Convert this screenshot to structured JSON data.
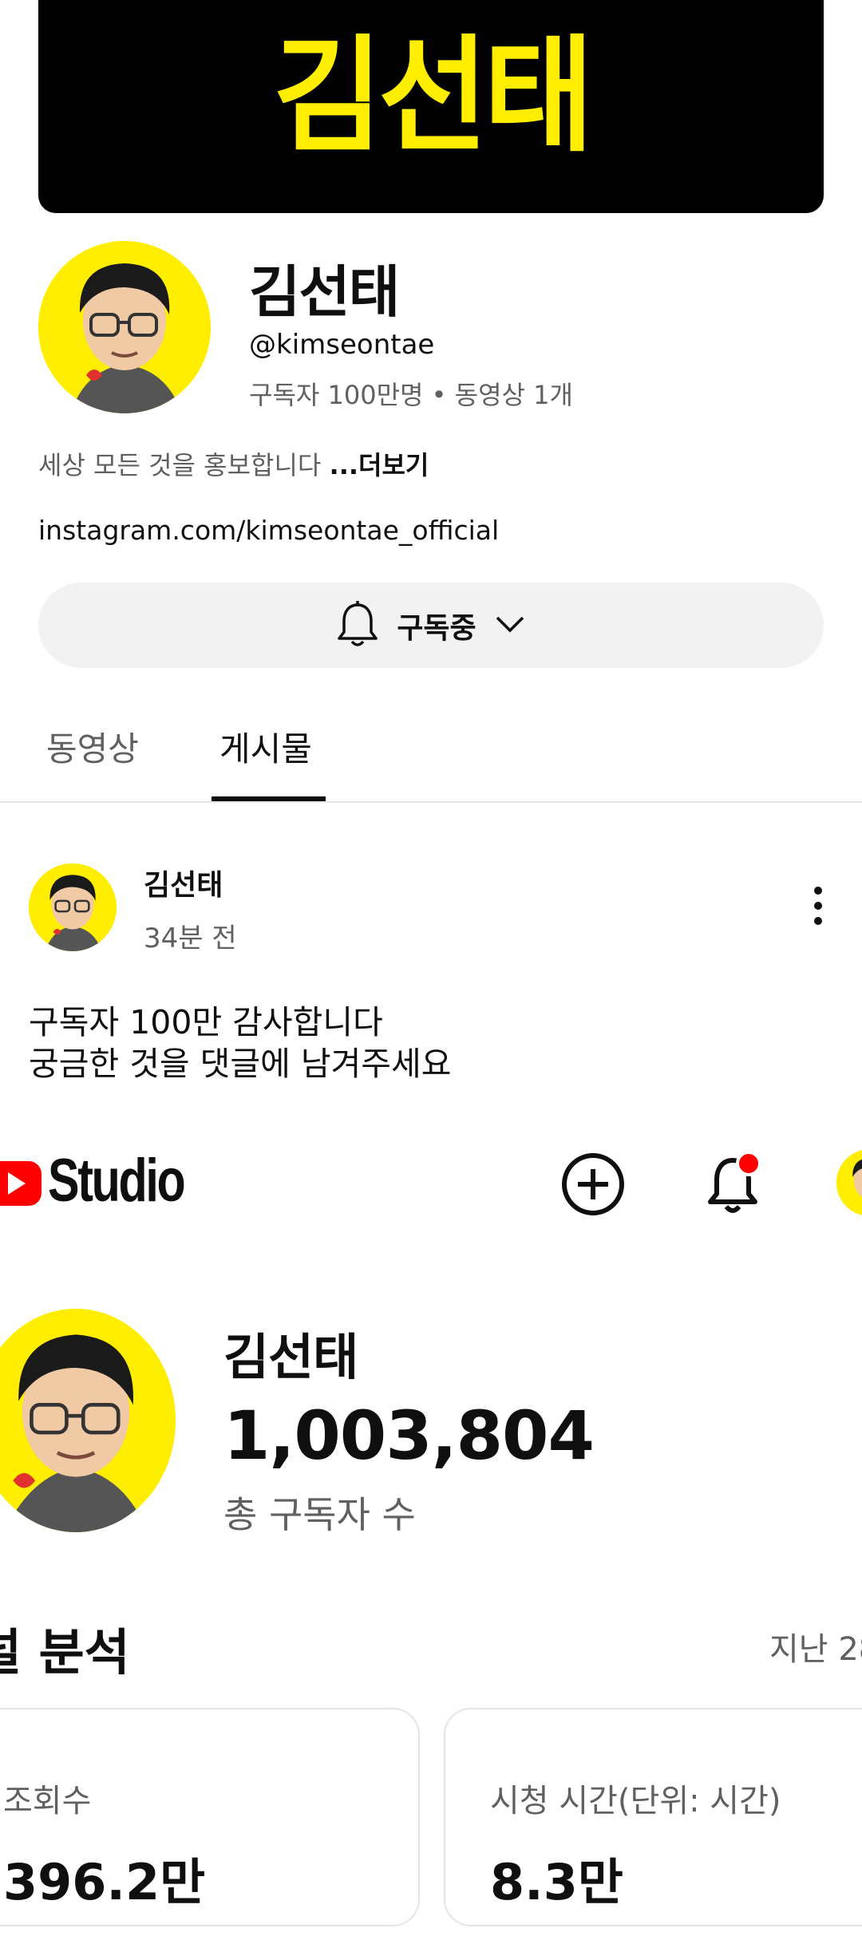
{
  "banner": {
    "text": "김선태"
  },
  "channel": {
    "name": "김선태",
    "handle": "@kimseontae",
    "meta": "구독자 100만명 • 동영상 1개",
    "description": "세상 모든 것을 홍보합니다",
    "more_label": "...더보기",
    "link": "instagram.com/kimseontae_official",
    "subscribe_label": "구독중"
  },
  "tabs": [
    {
      "label": "동영상",
      "active": false
    },
    {
      "label": "게시물",
      "active": true
    }
  ],
  "post": {
    "author": "김선태",
    "time": "34분 전",
    "lines": [
      "구독자 100만 감사합니다",
      "궁금한 것을 댓글에 남겨주세요"
    ]
  },
  "studio": {
    "logo_text": "Studio",
    "channel_name": "김선태",
    "subscriber_count": "1,003,804",
    "subscriber_label": "총 구독자 수",
    "analytics_title": "널 분석",
    "period": "지난 28",
    "cards": [
      {
        "label": "조회수",
        "value": "396.2만"
      },
      {
        "label": "시청 시간(단위: 시간)",
        "value": "8.3만"
      }
    ]
  },
  "colors": {
    "brand_yellow": "#ffee00",
    "youtube_red": "#ff0000",
    "notification_dot": "#ff0000",
    "text_primary": "#0f0f0f",
    "text_secondary": "#606060",
    "button_bg": "#f2f2f2"
  },
  "icons": [
    "bell-icon",
    "chevron-down-icon",
    "more-vert-icon",
    "youtube-logo-icon",
    "create-plus-icon",
    "notification-bell-icon"
  ]
}
